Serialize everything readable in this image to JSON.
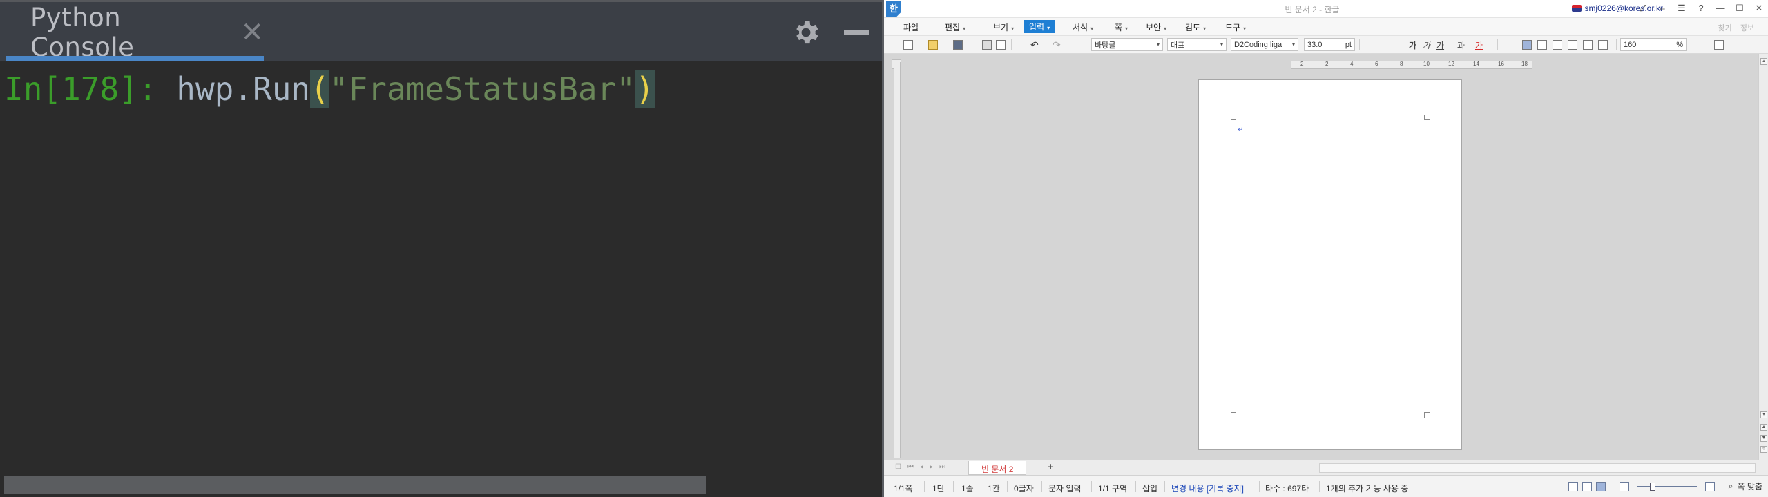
{
  "console": {
    "tab_title": "Python Console",
    "tab_close": "✕",
    "prompt": "In[178]: ",
    "code_object": "hwp.Run",
    "paren_open": "(",
    "code_string": "\"FrameStatusBar\"",
    "paren_close": ")"
  },
  "hwp": {
    "logo": "한",
    "window_title": "빈 문서 2 - 한글",
    "user_email": "smj0226@kores.or.kr",
    "title_icons": [
      "⤢",
      "⇔",
      "☰",
      "?",
      "—",
      "☐",
      "✕"
    ],
    "menu": [
      {
        "label": "파일",
        "chev": ""
      },
      {
        "label": "편집",
        "chev": "▾"
      },
      {
        "label": "보기",
        "chev": "▾"
      },
      {
        "label": "입력",
        "chev": "▾",
        "active": true
      },
      {
        "label": "서식",
        "chev": "▾"
      },
      {
        "label": "쪽",
        "chev": "▾"
      },
      {
        "label": "보안",
        "chev": "▾"
      },
      {
        "label": "검토",
        "chev": "▾"
      },
      {
        "label": "도구",
        "chev": "▾"
      }
    ],
    "menubar_right": [
      "찾기",
      "정보"
    ],
    "toolbar": {
      "style": "바탕글",
      "lang": "대표",
      "font": "D2Coding liga",
      "font_size": "33.0",
      "font_unit": "pt",
      "zoom": "160",
      "zoom_unit": "%",
      "format_glyphs": [
        "가",
        "가",
        "가",
        "과",
        "가"
      ]
    },
    "ruler_numbers": [
      "2",
      "2",
      "4",
      "6",
      "8",
      "10",
      "12",
      "14",
      "16",
      "18"
    ],
    "doc_tab": "빈 문서 2",
    "tab_add": "+",
    "status": {
      "page": "1/1쪽",
      "column": "1단",
      "line": "1줄",
      "col": "1칸",
      "chars": "0글자",
      "input_mode": "문자 입력",
      "section": "1/1 구역",
      "insert": "삽입",
      "track_changes": "변경 내용 [기록 중지]",
      "keystrokes": "타수 : 697타",
      "addons": "1개의 추가 기능 사용 중",
      "fit": "쪽 맞춤"
    },
    "colors": {
      "accent": "#1e7fd4",
      "tab_underline": "#4a86c7",
      "prompt": "#3b9d2a",
      "string": "#6a8759"
    }
  }
}
